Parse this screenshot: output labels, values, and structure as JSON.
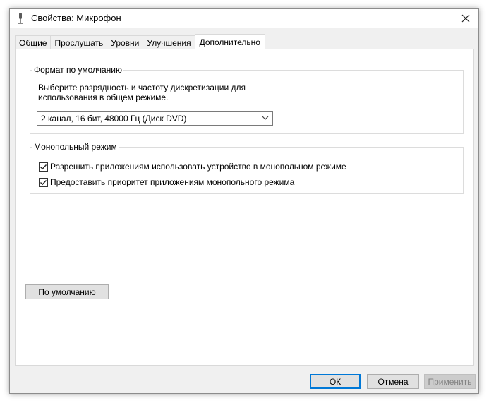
{
  "window": {
    "title": "Свойства: Микрофон",
    "close_icon": "close-icon",
    "title_icon": "microphone-icon"
  },
  "tabs": [
    {
      "label": "Общие",
      "active": false
    },
    {
      "label": "Прослушать",
      "active": false
    },
    {
      "label": "Уровни",
      "active": false
    },
    {
      "label": "Улучшения",
      "active": false
    },
    {
      "label": "Дополнительно",
      "active": true
    }
  ],
  "default_format": {
    "legend": "Формат по умолчанию",
    "description": "Выберите разрядность и частоту дискретизации для использования в общем режиме.",
    "selected": "2 канал, 16 бит, 48000 Гц (Диск DVD)"
  },
  "exclusive_mode": {
    "legend": "Монопольный режим",
    "options": [
      {
        "label": "Разрешить приложениям использовать устройство в монопольном режиме",
        "checked": true
      },
      {
        "label": "Предоставить приоритет приложениям монопольного режима",
        "checked": true
      }
    ]
  },
  "restore_defaults_label": "По умолчанию",
  "footer": {
    "ok": "ОК",
    "cancel": "Отмена",
    "apply": "Применить"
  },
  "colors": {
    "accent": "#0078d7",
    "dialog_bg": "#f0f0f0",
    "panel_bg": "#ffffff"
  }
}
